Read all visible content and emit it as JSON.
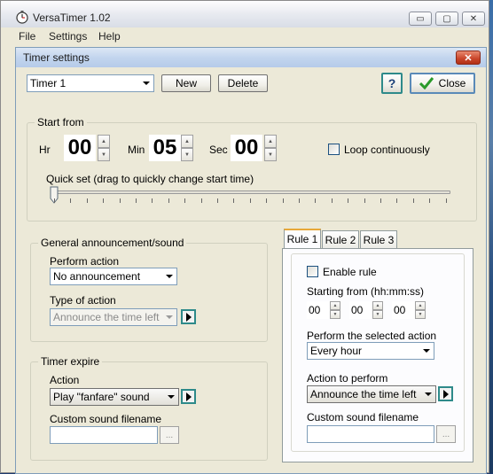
{
  "app": {
    "title": "VersaTimer 1.02",
    "menu": [
      "File",
      "Settings",
      "Help"
    ],
    "controls": {
      "minimize": "▭",
      "maximize": "▢",
      "close": "✕"
    }
  },
  "dialog": {
    "title": "Timer settings",
    "close": "✕",
    "timer_select": "Timer 1",
    "new_label": "New",
    "delete_label": "Delete",
    "help_label": "?",
    "close_label": "Close"
  },
  "start_from": {
    "title": "Start from",
    "hr_label": "Hr",
    "hr": "00",
    "min_label": "Min",
    "min": "05",
    "sec_label": "Sec",
    "sec": "00",
    "loop_label": "Loop continuously",
    "loop_checked": false,
    "quickset_label": "Quick set (drag to quickly change start time)",
    "quickset_value": 0
  },
  "general": {
    "title": "General announcement/sound",
    "perform_label": "Perform action",
    "perform_value": "No announcement",
    "type_label": "Type of action",
    "type_value": "Announce the time left"
  },
  "expire": {
    "title": "Timer expire",
    "action_label": "Action",
    "action_value": "Play \"fanfare\" sound",
    "sound_label": "Custom sound filename",
    "sound_value": "",
    "browse": "..."
  },
  "rules": {
    "tabs": [
      "Rule 1",
      "Rule 2",
      "Rule 3"
    ],
    "active_tab": 0,
    "enable_label": "Enable rule",
    "enable_checked": false,
    "starting_label": "Starting from (hh:mm:ss)",
    "hh": "00",
    "mm": "00",
    "ss": "00",
    "perform_label": "Perform the selected action",
    "perform_value": "Every hour",
    "action_label": "Action to perform",
    "action_value": "Announce the time left",
    "sound_label": "Custom sound filename",
    "sound_value": "",
    "browse": "..."
  },
  "colors": {
    "accent": "#2e8a8a",
    "tab_highlight": "#e8a838",
    "close_red": "#c9452a"
  }
}
